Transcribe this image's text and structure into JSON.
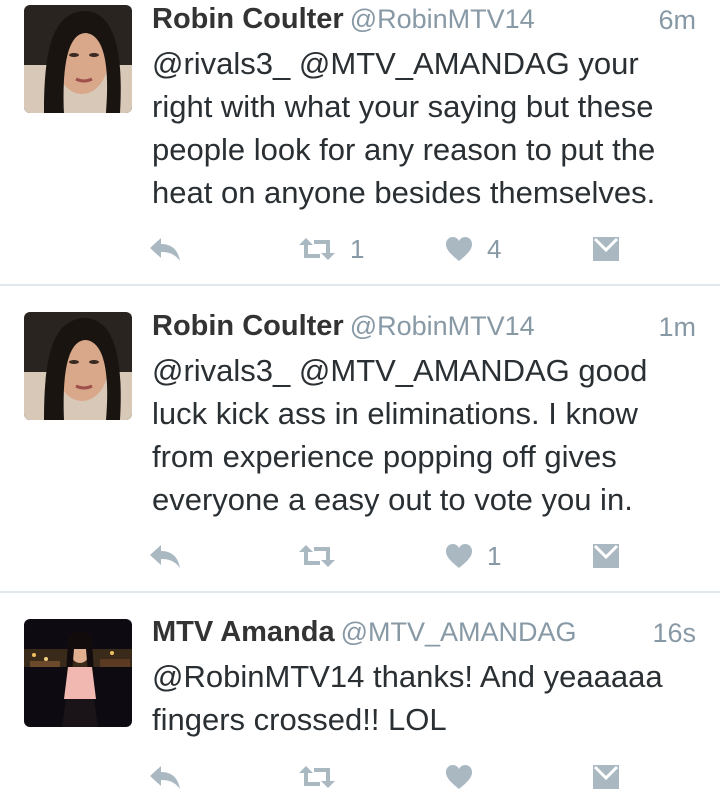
{
  "colors": {
    "text": "#292f33",
    "muted": "#8899a6",
    "divider": "#e1e8ed",
    "icon": "#aab8c2"
  },
  "tweets": [
    {
      "name": "Robin Coulter",
      "handle": "@RobinMTV14",
      "time": "6m",
      "lines": [
        "@rivals3_ @MTV_AMANDAG your",
        "right with what your saying but these",
        "people look for any reason to put the",
        "heat on anyone besides themselves."
      ],
      "retweets": "1",
      "likes": "4",
      "avatar_icon": "profile-photo-icon"
    },
    {
      "name": "Robin Coulter",
      "handle": "@RobinMTV14",
      "time": "1m",
      "lines": [
        "@rivals3_ @MTV_AMANDAG good",
        "luck kick ass in eliminations. I know",
        "from experience popping off gives",
        "everyone a easy out to vote you in."
      ],
      "retweets": "",
      "likes": "1",
      "avatar_icon": "profile-photo-icon"
    },
    {
      "name": "MTV Amanda",
      "handle": "@MTV_AMANDAG",
      "time": "16s",
      "lines": [
        "@RobinMTV14 thanks! And yeaaaaa",
        "fingers crossed!! LOL"
      ],
      "retweets": "",
      "likes": "",
      "avatar_icon": "profile-photo-icon"
    }
  ]
}
